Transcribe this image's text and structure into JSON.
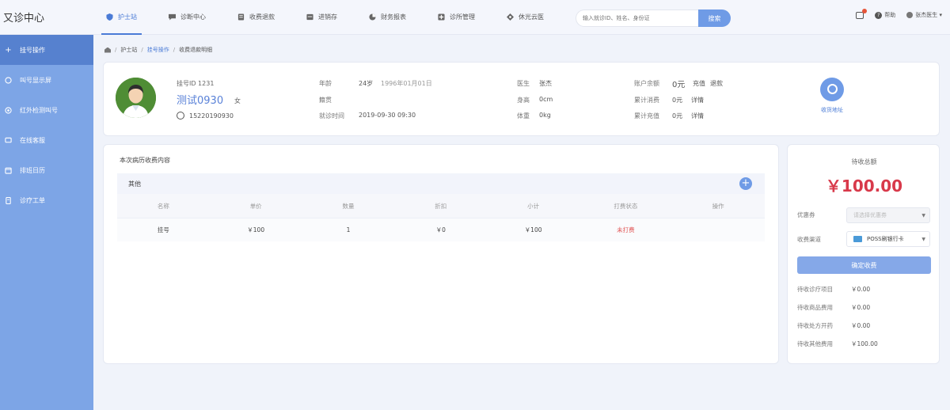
{
  "app": {
    "brand": "又诊中心"
  },
  "nav": [
    {
      "label": "护士站",
      "icon": "shield-icon",
      "active": true
    },
    {
      "label": "诊断中心",
      "icon": "chat-icon",
      "active": false
    },
    {
      "label": "收费退款",
      "icon": "receipt-icon",
      "active": false
    },
    {
      "label": "进销存",
      "icon": "box-icon",
      "active": false
    },
    {
      "label": "财务报表",
      "icon": "report-icon",
      "active": false
    },
    {
      "label": "诊所管理",
      "icon": "clinic-icon",
      "active": false
    },
    {
      "label": "休光云医",
      "icon": "diamond-icon",
      "active": false
    }
  ],
  "search": {
    "placeholder": "输入就诊ID、姓名、身份证",
    "button": "搜索"
  },
  "tools": {
    "help": "帮助",
    "user": "张杰医生 ▾"
  },
  "sidebar": [
    {
      "label": "挂号操作",
      "icon": "plus-icon",
      "active": true
    },
    {
      "label": "叫号显示屏",
      "icon": "screen-icon",
      "active": false
    },
    {
      "label": "红外检测叫号",
      "icon": "sensor-icon",
      "active": false
    },
    {
      "label": "在线客服",
      "icon": "service-icon",
      "active": false
    },
    {
      "label": "排班日历",
      "icon": "calendar-icon",
      "active": false
    },
    {
      "label": "诊疗工单",
      "icon": "ticket-icon",
      "active": false
    }
  ],
  "breadcrumb": {
    "home": "home-icon",
    "items": [
      "护士站",
      "挂号操作",
      "收费退款明细"
    ]
  },
  "patient": {
    "id_label": "挂号ID 1231",
    "name": "测试0930",
    "sex": "女",
    "phone": "15220190930",
    "age_label": "年龄",
    "age_value": "24岁",
    "birth": "1996年01月01日",
    "dept_label": "籍贯",
    "time_label": "就诊时间",
    "time_value": "2019-09-30 09:30",
    "doctor_label": "医生",
    "doctor_value": "张杰",
    "height_label": "身高",
    "height_value": "0cm",
    "weight_label": "体重",
    "weight_value": "0kg",
    "balance_label": "账户余额",
    "balance_value": "0元",
    "recharge": "充值",
    "refund": "退款",
    "consume_label": "累计消费",
    "consume_value": "0元",
    "consume_link": "详情",
    "charge_label": "累计充值",
    "charge_value": "0元",
    "charge_link": "详情",
    "action_label": "收货地址"
  },
  "content": {
    "title": "本次病历收费内容",
    "group": "其他",
    "columns": [
      "名称",
      "单价",
      "数量",
      "折扣",
      "小计",
      "打费状态",
      "操作"
    ],
    "rows": [
      {
        "name": "挂号",
        "price": "￥100",
        "qty": "1",
        "discount": "￥0",
        "subtotal": "￥100",
        "status": "未打费",
        "op": ""
      }
    ]
  },
  "payment": {
    "label": "待收总额",
    "amount": "￥100.00",
    "coupon_label": "优惠券",
    "coupon_placeholder": "请选择优惠券",
    "channel_label": "收费渠道",
    "channel_value": "POSS刷银行卡",
    "confirm": "确定收费",
    "summary": [
      {
        "label": "待收诊疗项目",
        "value": "￥0.00"
      },
      {
        "label": "待收商品费用",
        "value": "￥0.00"
      },
      {
        "label": "待收处方开药",
        "value": "￥0.00"
      },
      {
        "label": "待收其他费用",
        "value": "￥100.00"
      }
    ]
  },
  "colors": {
    "accent": "#4a7bd6",
    "sidebar": "#7da5e6",
    "sidebar_active": "#5681cf",
    "price": "#d8394a",
    "status_red": "#e05050"
  }
}
